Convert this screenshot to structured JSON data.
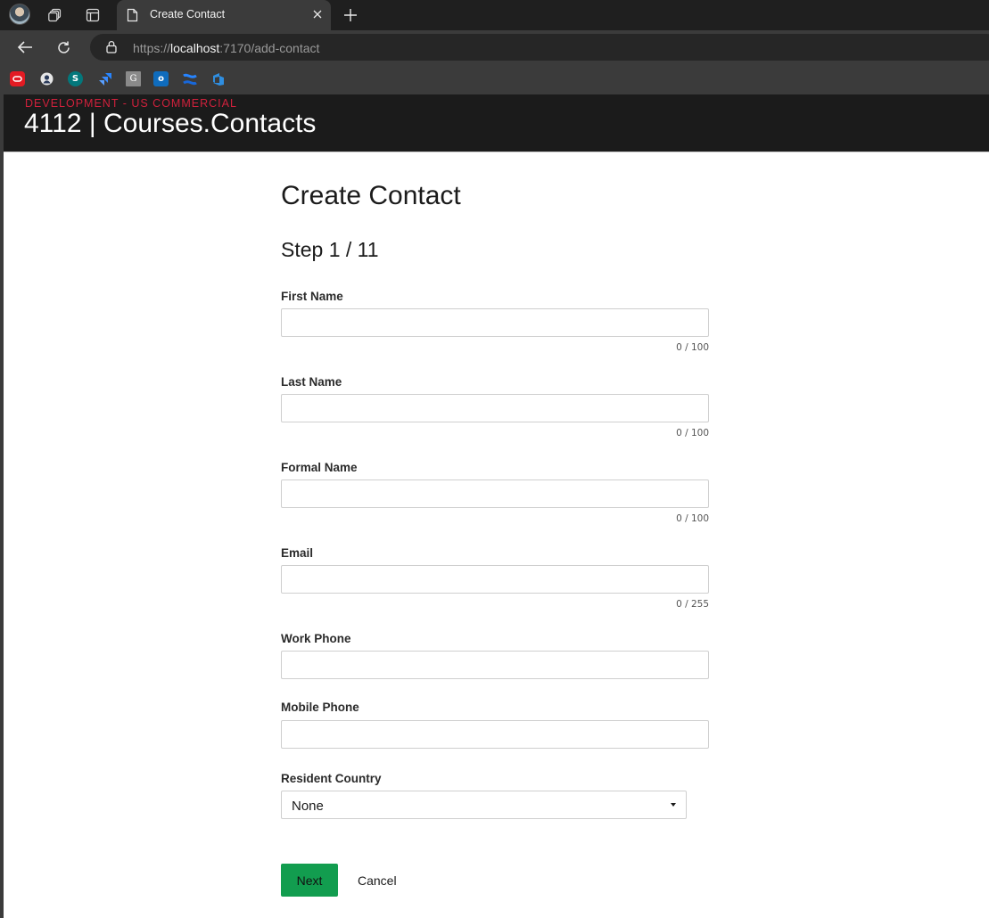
{
  "browser": {
    "tab_title": "Create Contact",
    "url_prefix": "https://",
    "url_host": "localhost",
    "url_path": ":7170/add-contact"
  },
  "bookmarks": [
    {
      "icon": "oracle-icon",
      "color": "#e31b23"
    },
    {
      "icon": "github-icon",
      "color": "#dcdcdc"
    },
    {
      "icon": "sharepoint-icon",
      "color": "#03787c"
    },
    {
      "icon": "jira-icon",
      "color": "#2684ff"
    },
    {
      "icon": "g-bookmark-icon",
      "color": "#8a8a8a"
    },
    {
      "icon": "outlook-icon",
      "color": "#0f6cbd"
    },
    {
      "icon": "confluence-icon",
      "color": "#2684ff"
    },
    {
      "icon": "azure-devops-icon",
      "color": "#2f8ee0"
    }
  ],
  "app": {
    "environment": "DEVELOPMENT - US COMMERCIAL",
    "title": "4112 | Courses.Contacts"
  },
  "form": {
    "title": "Create Contact",
    "step": "Step 1 / 11",
    "fields": {
      "first_name": {
        "label": "First Name",
        "value": "",
        "counter": "0 / 100"
      },
      "last_name": {
        "label": "Last Name",
        "value": "",
        "counter": "0 / 100"
      },
      "formal_name": {
        "label": "Formal Name",
        "value": "",
        "counter": "0 / 100"
      },
      "email": {
        "label": "Email",
        "value": "",
        "counter": "0 / 255"
      },
      "work_phone": {
        "label": "Work Phone",
        "value": ""
      },
      "mobile_phone": {
        "label": "Mobile Phone",
        "value": ""
      },
      "resident_country": {
        "label": "Resident Country",
        "selected": "None"
      }
    },
    "next_label": "Next",
    "cancel_label": "Cancel"
  },
  "colors": {
    "accent_green": "#129d4f",
    "env_red": "#d0213c",
    "header_bg": "#1b1b1b"
  }
}
